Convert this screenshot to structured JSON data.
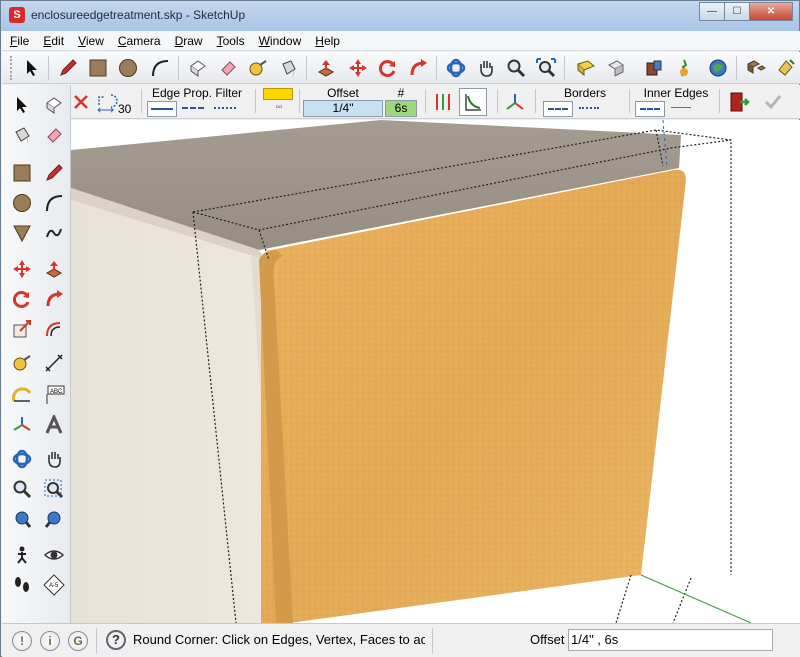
{
  "window": {
    "title": "enclosureedgetreatment.skp - SketchUp",
    "min_label": "—",
    "max_label": "☐",
    "close_label": "✕"
  },
  "menu": [
    "File",
    "Edit",
    "View",
    "Camera",
    "Draw",
    "Tools",
    "Window",
    "Help"
  ],
  "roundcorner": {
    "segments": "30",
    "edge_prop_filter": "Edge Prop. Filter",
    "offset_label": "Offset",
    "offset_value": "1/4\"",
    "count_label": "#",
    "count_value": "6s",
    "borders_label": "Borders",
    "inner_edges_label": "Inner Edges",
    "accent_color": "#ffd400"
  },
  "status": {
    "message": "Round Corner: Click on Edges, Vertex, Faces to ac",
    "vcb_label": "Offset",
    "vcb_value": "1/4\" , 6s"
  },
  "colors": {
    "wood": "#e8ae55",
    "box_side": "#ece3d6",
    "box_top": "#9d9589"
  }
}
